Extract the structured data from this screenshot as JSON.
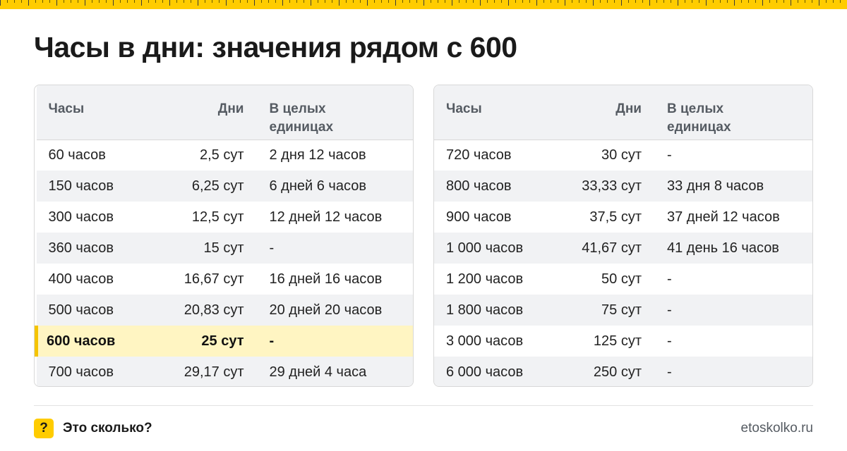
{
  "title": "Часы в дни: значения рядом с 600",
  "colors": {
    "accent": "#ffcc00",
    "highlight_row": "#fff5c2",
    "header_bg": "#f1f2f4"
  },
  "columns": {
    "hours": "Часы",
    "days": "Дни",
    "whole_line1": "В целых",
    "whole_line2": "единицах"
  },
  "left_table": {
    "rows": [
      {
        "hours": "60 часов",
        "days": "2,5 сут",
        "whole": "2 дня 12 часов"
      },
      {
        "hours": "150 часов",
        "days": "6,25 сут",
        "whole": "6 дней 6 часов"
      },
      {
        "hours": "300 часов",
        "days": "12,5 сут",
        "whole": "12 дней 12 часов"
      },
      {
        "hours": "360 часов",
        "days": "15 сут",
        "whole": "-"
      },
      {
        "hours": "400 часов",
        "days": "16,67 сут",
        "whole": "16 дней 16 часов"
      },
      {
        "hours": "500 часов",
        "days": "20,83 сут",
        "whole": "20 дней 20 часов"
      },
      {
        "hours": "600 часов",
        "days": "25 сут",
        "whole": "-",
        "highlighted": true
      },
      {
        "hours": "700 часов",
        "days": "29,17 сут",
        "whole": "29 дней 4 часа"
      }
    ]
  },
  "right_table": {
    "rows": [
      {
        "hours": "720 часов",
        "days": "30 сут",
        "whole": "-"
      },
      {
        "hours": "800 часов",
        "days": "33,33 сут",
        "whole": "33 дня 8 часов"
      },
      {
        "hours": "900 часов",
        "days": "37,5 сут",
        "whole": "37 дней 12 часов"
      },
      {
        "hours": "1 000 часов",
        "days": "41,67 сут",
        "whole": "41 день 16 часов"
      },
      {
        "hours": "1 200 часов",
        "days": "50 сут",
        "whole": "-"
      },
      {
        "hours": "1 800 часов",
        "days": "75 сут",
        "whole": "-"
      },
      {
        "hours": "3 000 часов",
        "days": "125 сут",
        "whole": "-"
      },
      {
        "hours": "6 000 часов",
        "days": "250 сут",
        "whole": "-"
      }
    ]
  },
  "footer": {
    "badge": "?",
    "label": "Это сколько?",
    "site": "etoskolko.ru"
  }
}
